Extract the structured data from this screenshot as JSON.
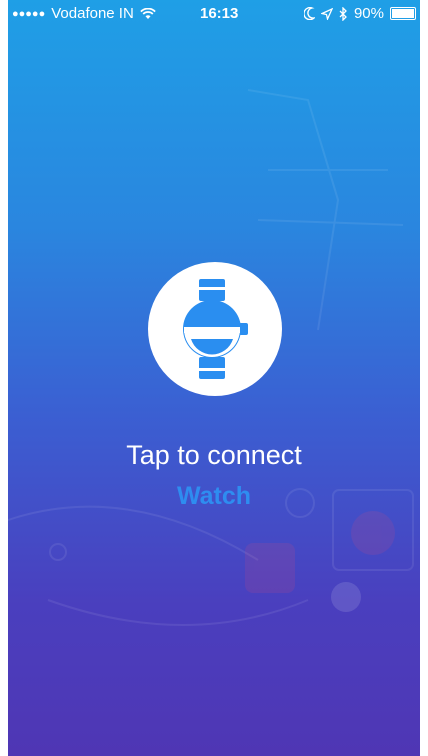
{
  "status_bar": {
    "signal_dots": "●●●●●",
    "carrier": "Vodafone IN",
    "wifi_icon": "wifi-icon",
    "time": "16:13",
    "moon_icon": "moon-icon",
    "location_icon": "location-arrow-icon",
    "bluetooth_icon": "bluetooth-icon",
    "battery_percent": "90%",
    "battery_level": 0.9
  },
  "main": {
    "prompt": "Tap to connect",
    "device": "Watch",
    "connect_icon": "watch-icon"
  },
  "colors": {
    "gradient_top": "#1f9fe6",
    "gradient_bottom": "#4f36b4",
    "accent": "#2e8df0",
    "icon_blue": "#2a8ef0"
  }
}
